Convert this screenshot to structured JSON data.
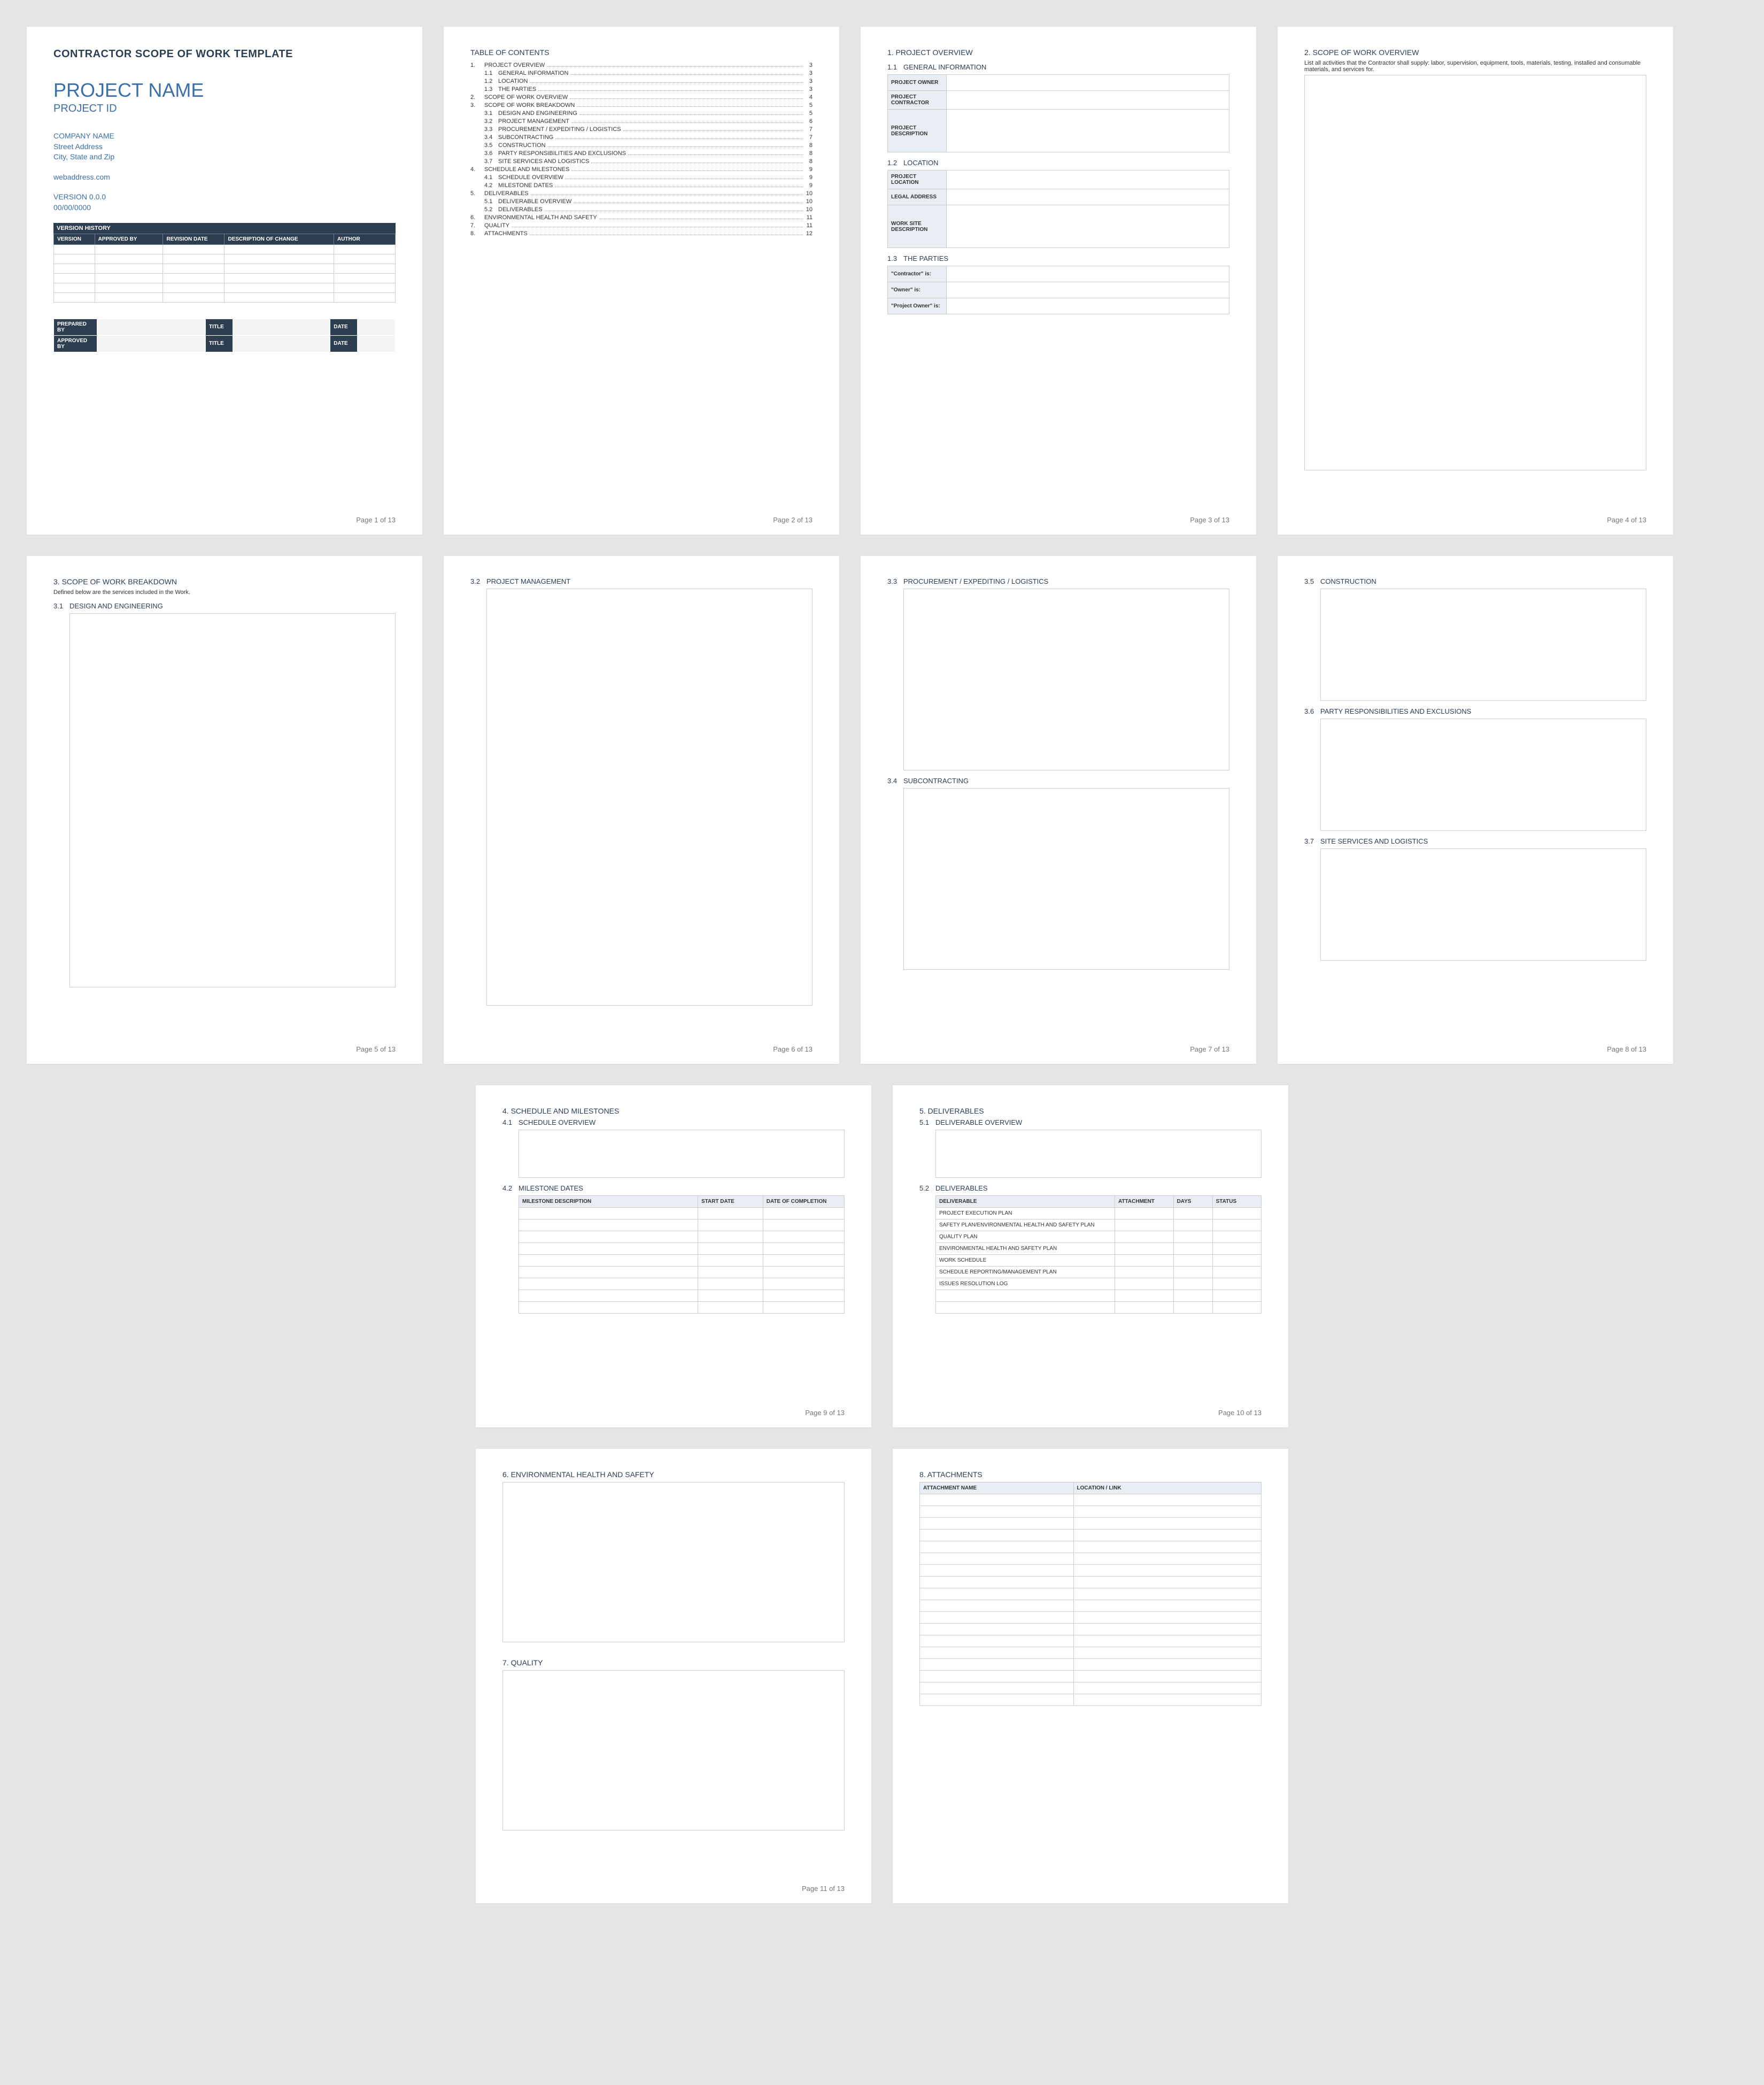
{
  "totalPages": 13,
  "page1": {
    "docTitle": "CONTRACTOR SCOPE OF WORK TEMPLATE",
    "projectName": "PROJECT NAME",
    "projectId": "PROJECT ID",
    "companyName": "COMPANY NAME",
    "street": "Street Address",
    "cityState": "City, State and Zip",
    "web": "webaddress.com",
    "version": "VERSION 0.0.0",
    "date": "00/00/0000",
    "versionHistory": "VERSION HISTORY",
    "vhCols": [
      "VERSION",
      "APPROVED BY",
      "REVISION DATE",
      "DESCRIPTION OF CHANGE",
      "AUTHOR"
    ],
    "sign": {
      "preparedBy": "PREPARED BY",
      "approvedBy": "APPROVED BY",
      "title": "TITLE",
      "date": "DATE"
    }
  },
  "toc": {
    "title": "TABLE OF CONTENTS",
    "lines": [
      {
        "num": "1.",
        "label": "PROJECT OVERVIEW",
        "pg": "3",
        "sub": false
      },
      {
        "num": "1.1",
        "label": "GENERAL INFORMATION",
        "pg": "3",
        "sub": true
      },
      {
        "num": "1.2",
        "label": "LOCATION",
        "pg": "3",
        "sub": true
      },
      {
        "num": "1.3",
        "label": "THE PARTIES",
        "pg": "3",
        "sub": true
      },
      {
        "num": "2.",
        "label": "SCOPE OF WORK OVERVIEW",
        "pg": "4",
        "sub": false
      },
      {
        "num": "3.",
        "label": "SCOPE OF WORK BREAKDOWN",
        "pg": "5",
        "sub": false
      },
      {
        "num": "3.1",
        "label": "DESIGN AND ENGINEERING",
        "pg": "5",
        "sub": true
      },
      {
        "num": "3.2",
        "label": "PROJECT MANAGEMENT",
        "pg": "6",
        "sub": true
      },
      {
        "num": "3.3",
        "label": "PROCUREMENT / EXPEDITING / LOGISTICS",
        "pg": "7",
        "sub": true
      },
      {
        "num": "3.4",
        "label": "SUBCONTRACTING",
        "pg": "7",
        "sub": true
      },
      {
        "num": "3.5",
        "label": "CONSTRUCTION",
        "pg": "8",
        "sub": true
      },
      {
        "num": "3.6",
        "label": "PARTY RESPONSIBILITIES AND EXCLUSIONS",
        "pg": "8",
        "sub": true
      },
      {
        "num": "3.7",
        "label": "SITE SERVICES AND LOGISTICS",
        "pg": "8",
        "sub": true
      },
      {
        "num": "4.",
        "label": "SCHEDULE AND MILESTONES",
        "pg": "9",
        "sub": false
      },
      {
        "num": "4.1",
        "label": "SCHEDULE OVERVIEW",
        "pg": "9",
        "sub": true
      },
      {
        "num": "4.2",
        "label": "MILESTONE DATES",
        "pg": "9",
        "sub": true
      },
      {
        "num": "5.",
        "label": "DELIVERABLES",
        "pg": "10",
        "sub": false
      },
      {
        "num": "5.1",
        "label": "DELIVERABLE OVERVIEW",
        "pg": "10",
        "sub": true
      },
      {
        "num": "5.2",
        "label": "DELIVERABLES",
        "pg": "10",
        "sub": true
      },
      {
        "num": "6.",
        "label": "ENVIRONMENTAL HEALTH AND SAFETY",
        "pg": "11",
        "sub": false
      },
      {
        "num": "7.",
        "label": "QUALITY",
        "pg": "11",
        "sub": false
      },
      {
        "num": "8.",
        "label": "ATTACHMENTS",
        "pg": "12",
        "sub": false
      }
    ]
  },
  "p3": {
    "h1": "1. PROJECT OVERVIEW",
    "s1": "GENERAL INFORMATION",
    "s1n": "1.1",
    "r1": "PROJECT OWNER",
    "r2": "PROJECT CONTRACTOR",
    "r3": "PROJECT DESCRIPTION",
    "s2": "LOCATION",
    "s2n": "1.2",
    "r4": "PROJECT LOCATION",
    "r5": "LEGAL ADDRESS",
    "r6": "WORK SITE DESCRIPTION",
    "s3": "THE PARTIES",
    "s3n": "1.3",
    "r7": "\"Contractor\" is:",
    "r8": "\"Owner\" is:",
    "r9": "\"Project Owner\" is:"
  },
  "p4": {
    "h": "2. SCOPE OF WORK OVERVIEW",
    "desc": "List all activities that the Contractor shall supply: labor, supervision, equipment, tools, materials, testing, installed and consumable materials, and services for."
  },
  "p5": {
    "h": "3. SCOPE OF WORK BREAKDOWN",
    "desc": "Defined below are the services included in the Work.",
    "s1n": "3.1",
    "s1": "DESIGN AND ENGINEERING"
  },
  "p6": {
    "s1n": "3.2",
    "s1": "PROJECT MANAGEMENT"
  },
  "p7": {
    "s1n": "3.3",
    "s1": "PROCUREMENT / EXPEDITING / LOGISTICS",
    "s2n": "3.4",
    "s2": "SUBCONTRACTING"
  },
  "p8": {
    "s1n": "3.5",
    "s1": "CONSTRUCTION",
    "s2n": "3.6",
    "s2": "PARTY RESPONSIBILITIES AND EXCLUSIONS",
    "s3n": "3.7",
    "s3": "SITE SERVICES AND LOGISTICS"
  },
  "p9": {
    "h": "4. SCHEDULE AND MILESTONES",
    "s1n": "4.1",
    "s1": "SCHEDULE OVERVIEW",
    "s2n": "4.2",
    "s2": "MILESTONE DATES",
    "cols": [
      "MILESTONE DESCRIPTION",
      "START DATE",
      "DATE OF COMPLETION"
    ]
  },
  "p10": {
    "h": "5. DELIVERABLES",
    "s1n": "5.1",
    "s1": "DELIVERABLE OVERVIEW",
    "s2n": "5.2",
    "s2": "DELIVERABLES",
    "cols": [
      "DELIVERABLE",
      "ATTACHMENT",
      "DAYS",
      "STATUS"
    ],
    "rows": [
      "PROJECT EXECUTION PLAN",
      "SAFETY PLAN/ENVIRONMENTAL HEALTH AND SAFETY PLAN",
      "QUALITY PLAN",
      "ENVIRONMENTAL HEALTH AND SAFETY PLAN",
      "WORK SCHEDULE",
      "SCHEDULE REPORTING/MANAGEMENT PLAN",
      "ISSUES RESOLUTION LOG"
    ]
  },
  "p11": {
    "h1": "6. ENVIRONMENTAL HEALTH AND SAFETY",
    "h2": "7. QUALITY"
  },
  "p12": {
    "h": "8. ATTACHMENTS",
    "cols": [
      "ATTACHMENT NAME",
      "LOCATION / LINK"
    ]
  },
  "footers": {
    "p1": "Page 1 of 13",
    "p2": "Page 2 of 13",
    "p3": "Page 3 of 13",
    "p4": "Page 4 of 13",
    "p5": "Page 5 of 13",
    "p6": "Page 6 of 13",
    "p7": "Page 7 of 13",
    "p8": "Page 8 of 13",
    "p9": "Page 9 of 13",
    "p10": "Page 10 of 13",
    "p11": "Page 11 of 13"
  }
}
